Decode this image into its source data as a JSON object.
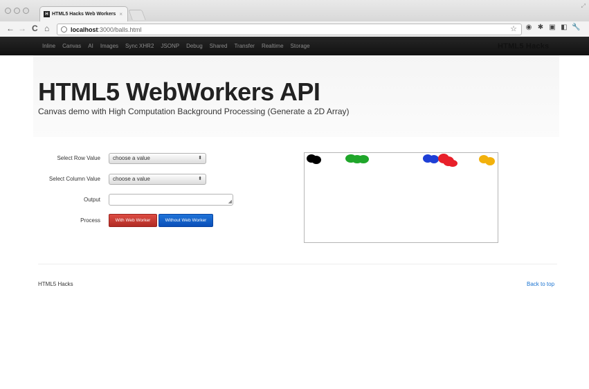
{
  "browser": {
    "tab_title": "HTML5 Hacks Web Workers",
    "tab_favicon": "H",
    "tab_close": "×",
    "url_host": "localhost",
    "url_rest": ":3000/balls.html",
    "icons": [
      "back-icon",
      "forward-icon",
      "reload-icon",
      "home-icon",
      "bookmark-star-icon",
      "extension-icons"
    ]
  },
  "navbar": {
    "links": [
      "Inline",
      "Canvas",
      "AI",
      "Images",
      "Sync XHR2",
      "JSONP",
      "Debug",
      "Shared",
      "Transfer",
      "Realtime",
      "Storage"
    ],
    "brand": "HTML5 Hacks"
  },
  "page": {
    "title": "HTML5 WebWorkers API",
    "subtitle": "Canvas demo with High Computation Background Processing (Generate a 2D Array)"
  },
  "form": {
    "row_label": "Select Row Value",
    "row_select": "choose a value",
    "column_label": "Select Column Value",
    "column_select": "choose a value",
    "output_label": "Output",
    "output_value": "",
    "process_label": "Process",
    "with_worker_button": "With Web Worker",
    "without_worker_button": "Without Web Worker"
  },
  "canvas": {
    "balls": [
      {
        "color": "#000000"
      },
      {
        "color": "#1fa62a"
      },
      {
        "color": "#1e3fd6"
      },
      {
        "color": "#e8202a"
      },
      {
        "color": "#f2b10c"
      }
    ]
  },
  "footer": {
    "left": "HTML5 Hacks",
    "back_to_top": "Back to top"
  },
  "colors": {
    "navbar_bg": "#1b1b1b",
    "danger": "#c53a32",
    "primary": "#0e5fcc",
    "link": "#1a73d1"
  }
}
